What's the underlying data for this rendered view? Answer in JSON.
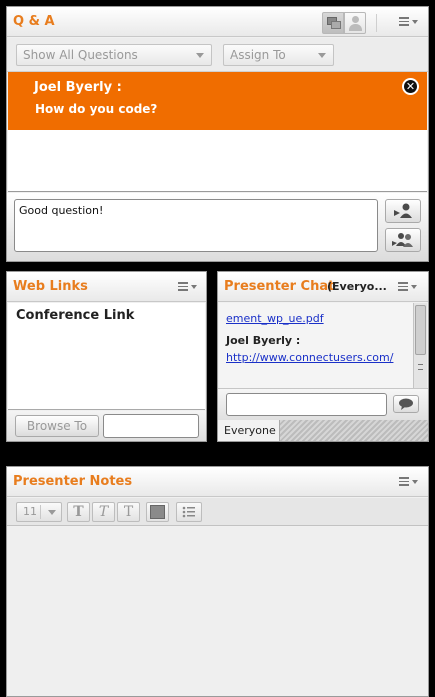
{
  "qa": {
    "title": "Q & A",
    "filter_dropdown": "Show All Questions",
    "assign_dropdown": "Assign To",
    "question": {
      "asker": "Joel  Byerly :",
      "text": "How do you code?"
    },
    "answer_input_value": "Good question!"
  },
  "web_links": {
    "title": "Web Links",
    "items": [
      "Conference Link"
    ],
    "browse_button": "Browse To",
    "url_input_value": ""
  },
  "presenter_chat": {
    "title": "Presenter Chat",
    "audience_label": "(Everyo...",
    "messages": [
      {
        "link": "ement_wp_ue.pdf"
      },
      {
        "sender": "Joel  Byerly :",
        "link": "http://www.connectusers.com/"
      }
    ],
    "message_input_value": "",
    "tab": "Everyone"
  },
  "presenter_notes": {
    "title": "Presenter Notes",
    "font_size": "11",
    "format_buttons": {
      "bold": "T",
      "italic": "T",
      "underline": "T"
    }
  },
  "colors": {
    "accent": "#e87d1e",
    "question_banner": "#f06d00",
    "link": "#1a30c8"
  },
  "icons": [
    "view-both-icon",
    "view-single-icon",
    "pod-menu-icon",
    "close-icon",
    "send-answer-icon",
    "send-privately-icon",
    "send-chat-icon",
    "color-swatch-icon",
    "bullet-list-icon"
  ]
}
